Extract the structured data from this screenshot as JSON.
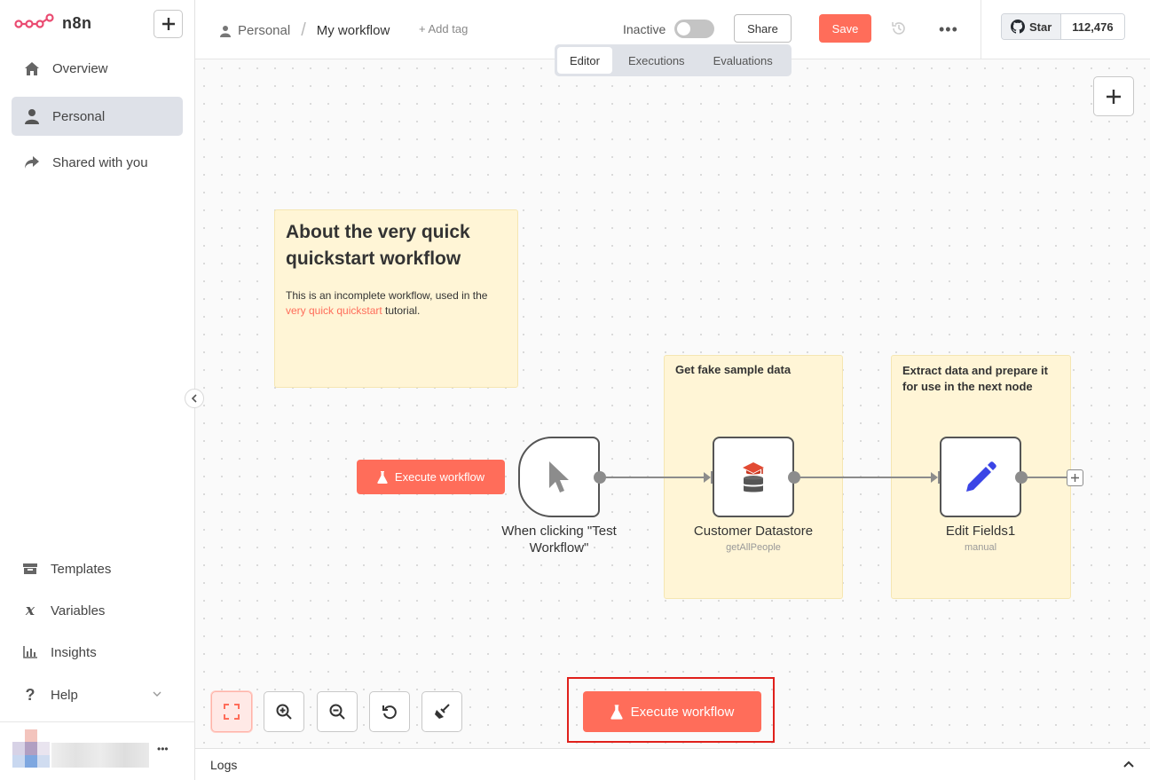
{
  "app": {
    "name": "n8n"
  },
  "sidebar": {
    "items": [
      {
        "label": "Overview",
        "icon": "home-icon"
      },
      {
        "label": "Personal",
        "icon": "user-icon"
      },
      {
        "label": "Shared with you",
        "icon": "share-icon"
      }
    ],
    "bottom_items": [
      {
        "label": "Templates",
        "icon": "box-icon"
      },
      {
        "label": "Variables",
        "icon": "variable-icon"
      },
      {
        "label": "Insights",
        "icon": "chart-icon"
      },
      {
        "label": "Help",
        "icon": "question-icon"
      }
    ],
    "user_more": "•••"
  },
  "header": {
    "project": "Personal",
    "workflow_name": "My workflow",
    "add_tag": "+ Add tag",
    "status_label": "Inactive",
    "share_label": "Share",
    "save_label": "Save",
    "more_label": "•••",
    "github": {
      "star_label": "Star",
      "count": "112,476"
    }
  },
  "tabs": [
    {
      "label": "Editor",
      "active": true
    },
    {
      "label": "Executions",
      "active": false
    },
    {
      "label": "Evaluations",
      "active": false
    }
  ],
  "canvas": {
    "sticky_main": {
      "title": "About the very quick quickstart workflow",
      "text_before": "This is an incomplete workflow, used in the ",
      "link_text": "very quick quickstart",
      "text_after": " tutorial."
    },
    "sticky_a": "Get fake sample data",
    "sticky_b": "Extract data and prepare it for use in the next node",
    "execute_small": "Execute workflow",
    "nodes": [
      {
        "label": "When clicking \"Test Workflow\"",
        "sub": ""
      },
      {
        "label": "Customer Datastore",
        "sub": "getAllPeople"
      },
      {
        "label": "Edit Fields1",
        "sub": "manual"
      }
    ],
    "execute_main": "Execute workflow"
  },
  "logs": {
    "label": "Logs"
  },
  "colors": {
    "accent": "#ff6d5a",
    "highlight": "#e0201b",
    "sticky": "#fff5d6"
  }
}
